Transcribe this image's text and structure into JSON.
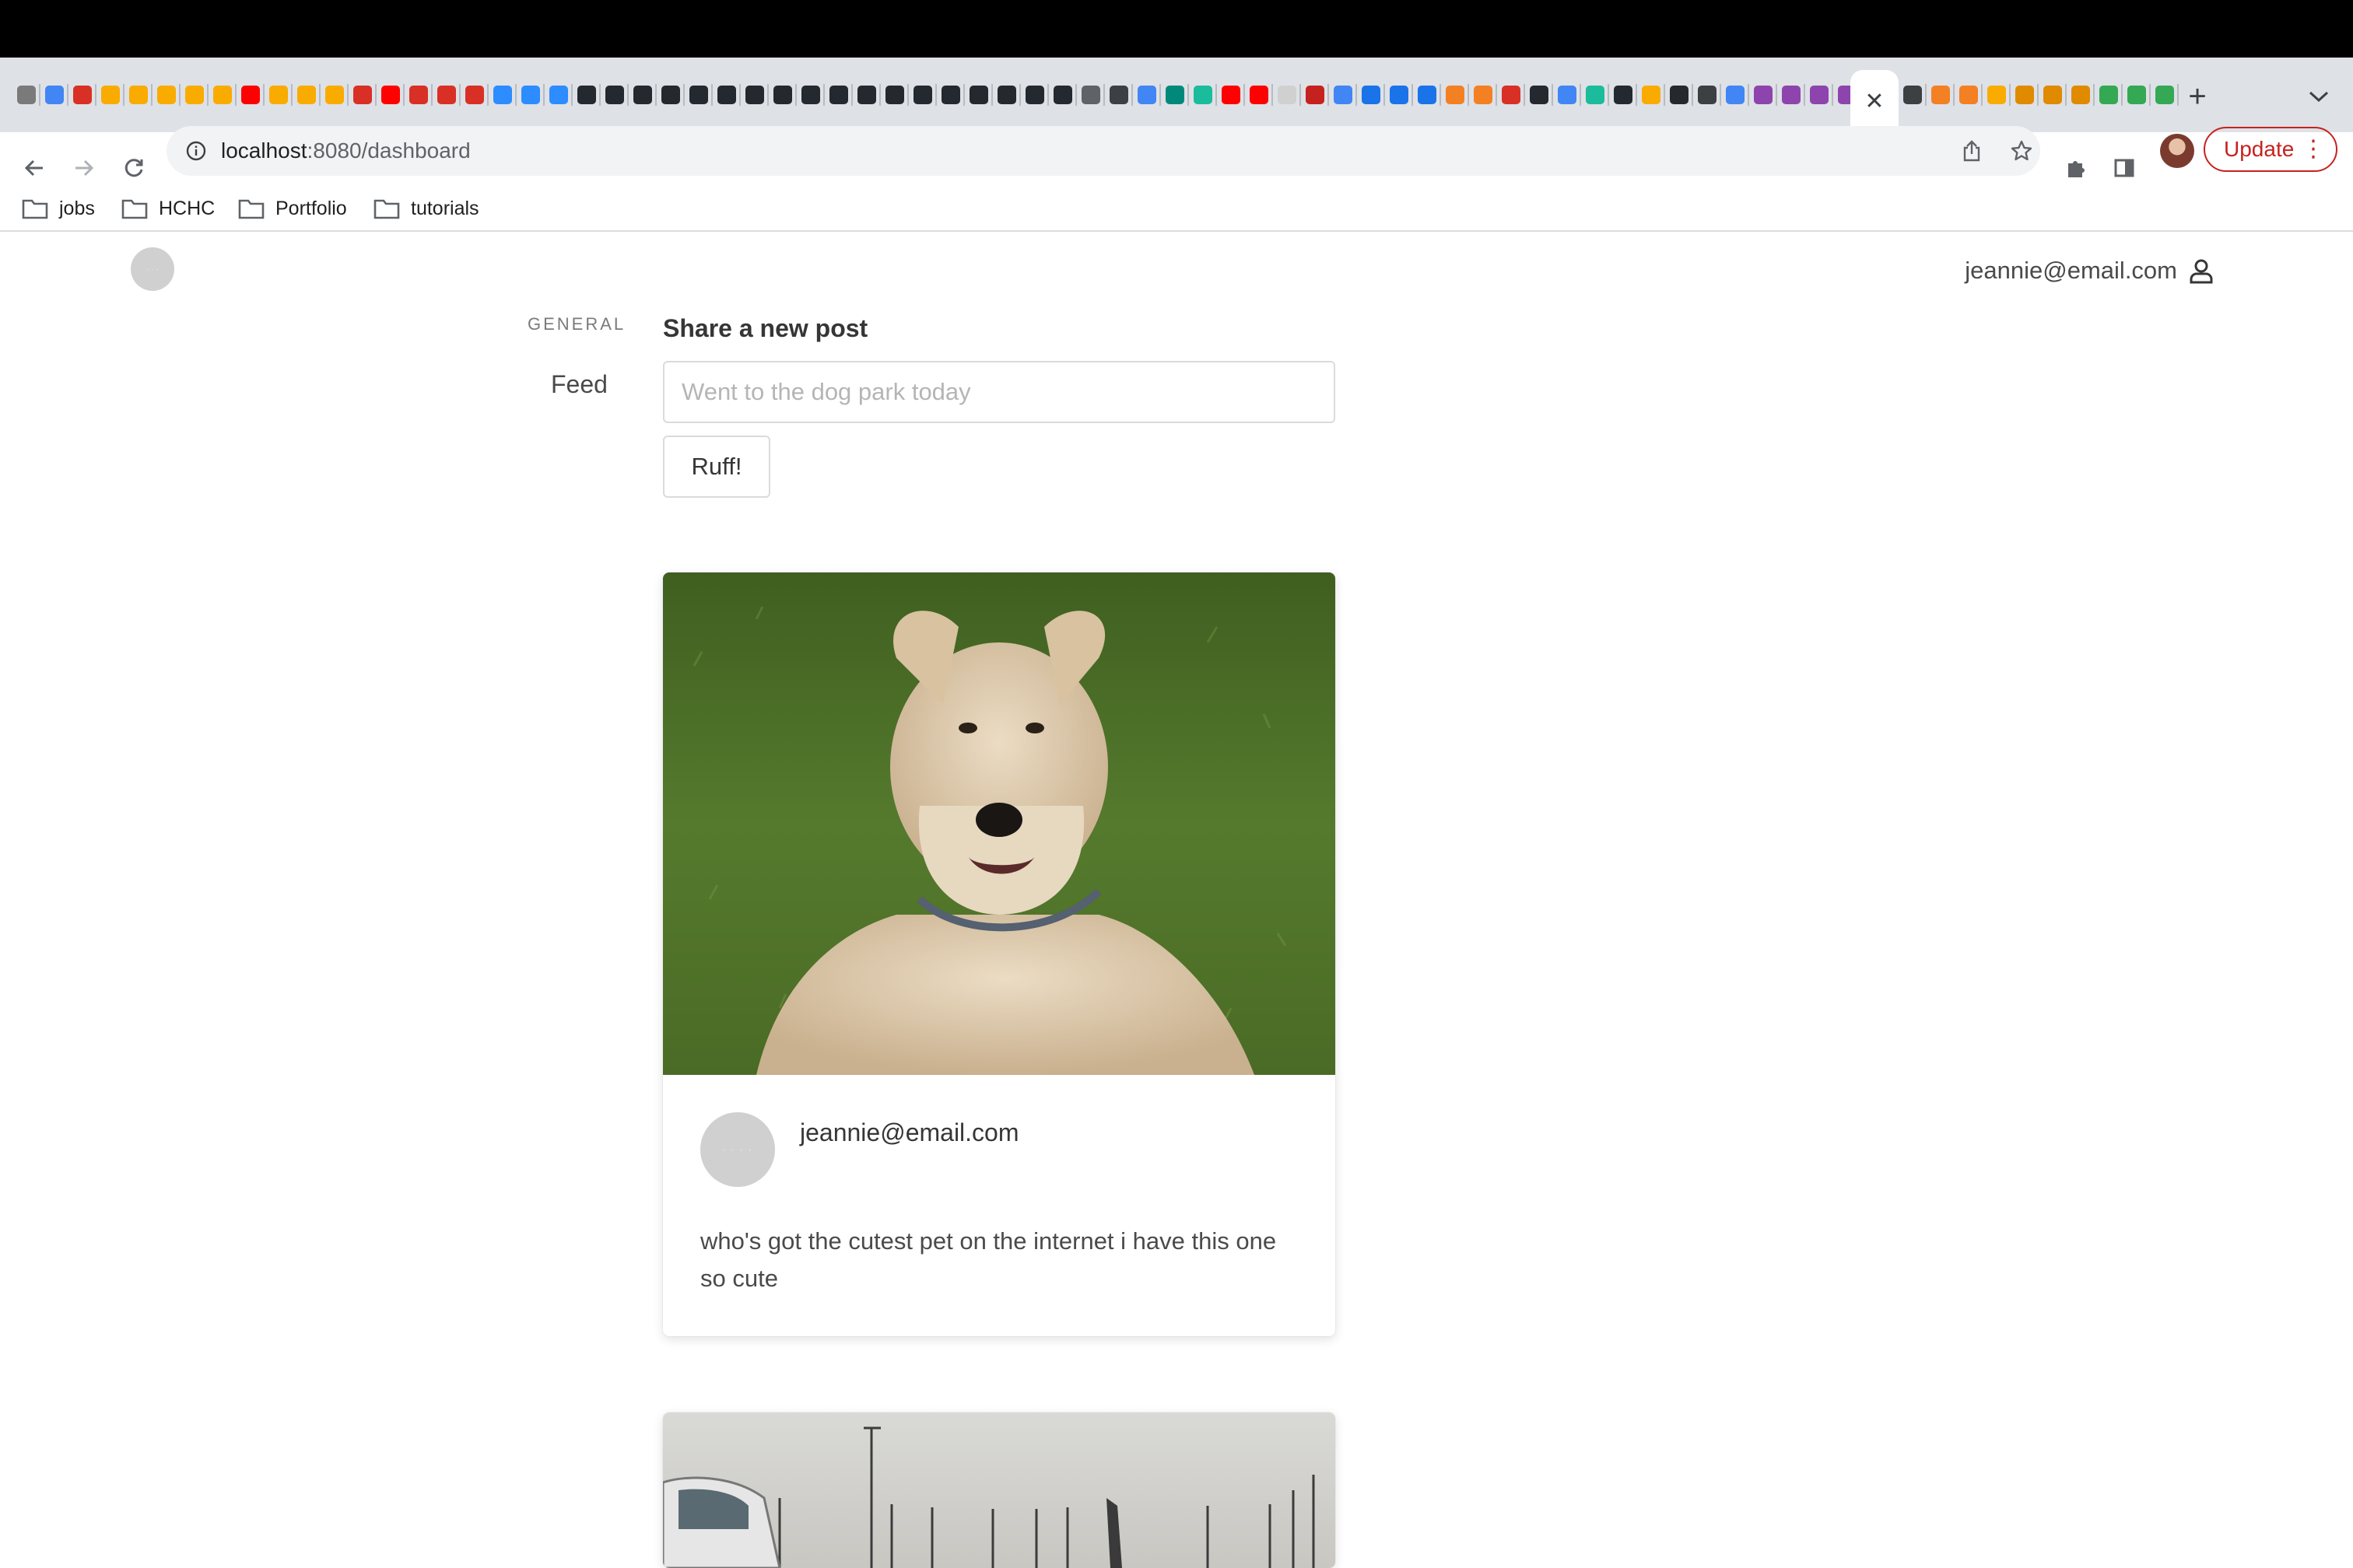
{
  "browser": {
    "active_tab_close": "✕",
    "new_tab": "+",
    "url_host": "localhost",
    "url_path": ":8080/dashboard",
    "update_label": "Update",
    "update_menu": "⋮",
    "tab_favicon_colors": [
      "#7a7a7a",
      "#4285f4",
      "#d93025",
      "#f9ab00",
      "#f9ab00",
      "#f9ab00",
      "#f9ab00",
      "#f9ab00",
      "#ff0000",
      "#f9ab00",
      "#f9ab00",
      "#f9ab00",
      "#d93025",
      "#ff0000",
      "#d93025",
      "#d93025",
      "#d93025",
      "#2d8cff",
      "#2d8cff",
      "#2d8cff",
      "#24292f",
      "#24292f",
      "#24292f",
      "#24292f",
      "#24292f",
      "#24292f",
      "#24292f",
      "#24292f",
      "#24292f",
      "#24292f",
      "#24292f",
      "#24292f",
      "#24292f",
      "#24292f",
      "#24292f",
      "#24292f",
      "#24292f",
      "#24292f",
      "#5f6368",
      "#3c4043",
      "#4285f4",
      "#00897b",
      "#1abc9c",
      "#ff0000",
      "#ff0000",
      "#d0d0d0",
      "#c5221f",
      "#4285f4",
      "#1a73e8",
      "#1a73e8",
      "#1a73e8",
      "#f48024",
      "#f48024",
      "#d93025",
      "#24292f",
      "#4285f4",
      "#1abc9c",
      "#24292f",
      "#f9ab00",
      "#24292f",
      "#3c4043",
      "#4285f4",
      "#8e44ad",
      "#8e44ad",
      "#8e44ad",
      "#8e44ad"
    ],
    "tab_favicon_colors_right": [
      "#3c4043",
      "#f48024",
      "#f48024",
      "#f9ab00",
      "#e08a00",
      "#e08a00",
      "#e08a00",
      "#34a853",
      "#34a853",
      "#34a853"
    ]
  },
  "bookmarks": [
    {
      "label": "jobs"
    },
    {
      "label": "HCHC"
    },
    {
      "label": "Portfolio"
    },
    {
      "label": "tutorials"
    }
  ],
  "app": {
    "user_email": "jeannie@email.com",
    "menu_label": "GENERAL",
    "menu_feed": "Feed",
    "post_heading": "Share a new post",
    "post_placeholder": "Went to the dog park today",
    "post_button": "Ruff!"
  },
  "feed": [
    {
      "author": "jeannie@email.com",
      "text": "who's got the cutest pet on the internet i have this one so cute",
      "image": "curly-haired terrier sitting on grass"
    }
  ],
  "colors": {
    "accent_update": "#c5221f",
    "avatar_placeholder": "#d0d0d0",
    "grass": "#4f6e2a"
  }
}
